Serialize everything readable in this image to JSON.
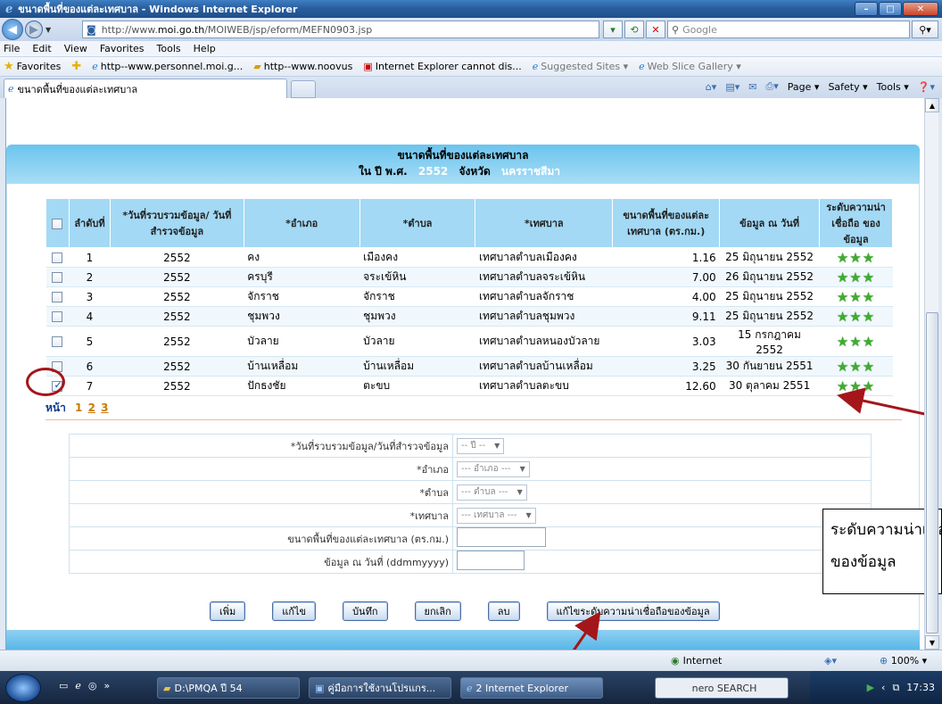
{
  "window": {
    "title": "ขนาดพื้นที่ของแต่ละเทศบาล - Windows Internet Explorer",
    "minimize": "–",
    "maximize": "□",
    "close": "✕"
  },
  "address": {
    "prefix": "http://www.",
    "domain": "moi.go.th",
    "path": "/MOIWEB/jsp/eform/MEFN0903.jsp",
    "search_placeholder": "Google"
  },
  "menu": [
    "File",
    "Edit",
    "View",
    "Favorites",
    "Tools",
    "Help"
  ],
  "favorites": {
    "label": "Favorites",
    "items": [
      "http--www.personnel.moi.g...",
      "http--www.noovus",
      "Internet Explorer cannot dis...",
      "Suggested Sites ▾",
      "Web Slice Gallery ▾"
    ]
  },
  "tab": {
    "label": "ขนาดพื้นที่ของแต่ละเทศบาล"
  },
  "commands": [
    "Page ▾",
    "Safety ▾",
    "Tools ▾"
  ],
  "page": {
    "title": "ขนาดพื้นที่ของแต่ละเทศบาล",
    "year_label": "ใน ปี พ.ศ.",
    "year_value": "2552",
    "province_label": "จังหวัด",
    "province_value": "นครราชสีมา"
  },
  "table": {
    "headers": {
      "no": "ลำดับที่",
      "date": "*วันที่รวบรวมข้อมูล/ วันที่สำรวจข้อมูล",
      "amphoe": "*อำเภอ",
      "tambon": "*ตำบล",
      "municipality": "*เทศบาล",
      "area": "ขนาดพื้นที่ของแต่ละเทศบาล (ตร.กม.)",
      "asof": "ข้อมูล ณ วันที่",
      "reliability": "ระดับความน่าเชื่อถือ ของข้อมูล"
    },
    "rows": [
      {
        "no": "1",
        "date": "2552",
        "amphoe": "คง",
        "tambon": "เมืองคง",
        "municipality": "เทศบาลตำบลเมืองคง",
        "area": "1.16",
        "asof": "25 มิถุนายน 2552",
        "stars": "★★★"
      },
      {
        "no": "2",
        "date": "2552",
        "amphoe": "ครบุรี",
        "tambon": "จระเข้หิน",
        "municipality": "เทศบาลตำบลจระเข้หิน",
        "area": "7.00",
        "asof": "26 มิถุนายน 2552",
        "stars": "★★★"
      },
      {
        "no": "3",
        "date": "2552",
        "amphoe": "จักราช",
        "tambon": "จักราช",
        "municipality": "เทศบาลตำบลจักราช",
        "area": "4.00",
        "asof": "25 มิถุนายน 2552",
        "stars": "★★★"
      },
      {
        "no": "4",
        "date": "2552",
        "amphoe": "ชุมพวง",
        "tambon": "ชุมพวง",
        "municipality": "เทศบาลตำบลชุมพวง",
        "area": "9.11",
        "asof": "25 มิถุนายน 2552",
        "stars": "★★★"
      },
      {
        "no": "5",
        "date": "2552",
        "amphoe": "บัวลาย",
        "tambon": "บัวลาย",
        "municipality": "เทศบาลตำบลหนองบัวลาย",
        "area": "3.03",
        "asof": "15 กรกฎาคม 2552",
        "stars": "★★★"
      },
      {
        "no": "6",
        "date": "2552",
        "amphoe": "บ้านเหลื่อม",
        "tambon": "บ้านเหลื่อม",
        "municipality": "เทศบาลตำบลบ้านเหลื่อม",
        "area": "3.25",
        "asof": "30 กันยายน 2551",
        "stars": "★★★"
      },
      {
        "no": "7",
        "date": "2552",
        "amphoe": "ปักธงชัย",
        "tambon": "ตะขบ",
        "municipality": "เทศบาลตำบลตะขบ",
        "area": "12.60",
        "asof": "30 ตุลาคม 2551",
        "stars": "★★★"
      }
    ]
  },
  "pager": {
    "label": "หน้า",
    "p1": "1",
    "p2": "2",
    "p3": "3"
  },
  "form": {
    "date_label": "*วันที่รวบรวมข้อมูล/วันที่สำรวจข้อมูล",
    "date_select": "-- ปี --",
    "amphoe_label": "*อำเภอ",
    "amphoe_select": "--- อำเภอ ---",
    "tambon_label": "*ตำบล",
    "tambon_select": "--- ตำบล ---",
    "municipality_label": "*เทศบาล",
    "municipality_select": "--- เทศบาล ---",
    "area_label": "ขนาดพื้นที่ของแต่ละเทศบาล (ตร.กม.)",
    "asof_label": "ข้อมูล ณ วันที่ (ddmmyyyy)"
  },
  "buttons": {
    "add": "เพิ่ม",
    "edit": "แก้ไข",
    "save": "บันทึก",
    "cancel": "ยกเลิก",
    "delete": "ลบ",
    "edit_reliability": "แก้ไขระดับความน่าเชื่อถือของข้อมูล"
  },
  "callout": {
    "line1": "ระดับความน่าเชื่อถือ",
    "line2": "ของข้อมูล"
  },
  "status": {
    "zone": "Internet",
    "zoom": "100% ▾"
  },
  "taskbar": {
    "items": [
      "D:\\PMQA ปี 54",
      "คู่มือการใช้งานโปรแกร...",
      "2 Internet Explorer",
      "nero SEARCH"
    ],
    "clock": "17:33"
  },
  "colors": {
    "header_band": "#6cc4ee",
    "table_header": "#a3d9f5",
    "stars": "#3cae2c",
    "annotation": "#a4161a"
  }
}
